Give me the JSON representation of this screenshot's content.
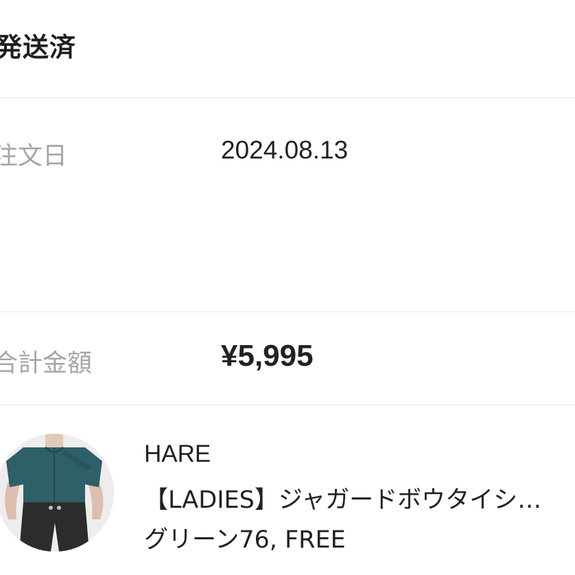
{
  "order": {
    "status": "発送済",
    "date_label": "注文日",
    "date_value": "2024.08.13",
    "total_label": "合計金額",
    "total_value": "¥5,995"
  },
  "product": {
    "image_icon": "product-photo",
    "brand": "HARE",
    "name": "【LADIES】ジャガードボウタイシ…",
    "variant": "グリーン76, FREE"
  },
  "colors": {
    "divider": "#e6e6e6",
    "label": "#a5a5a5",
    "text": "#222222",
    "shirt": "#2f5f68",
    "pants": "#2c2c2c"
  }
}
